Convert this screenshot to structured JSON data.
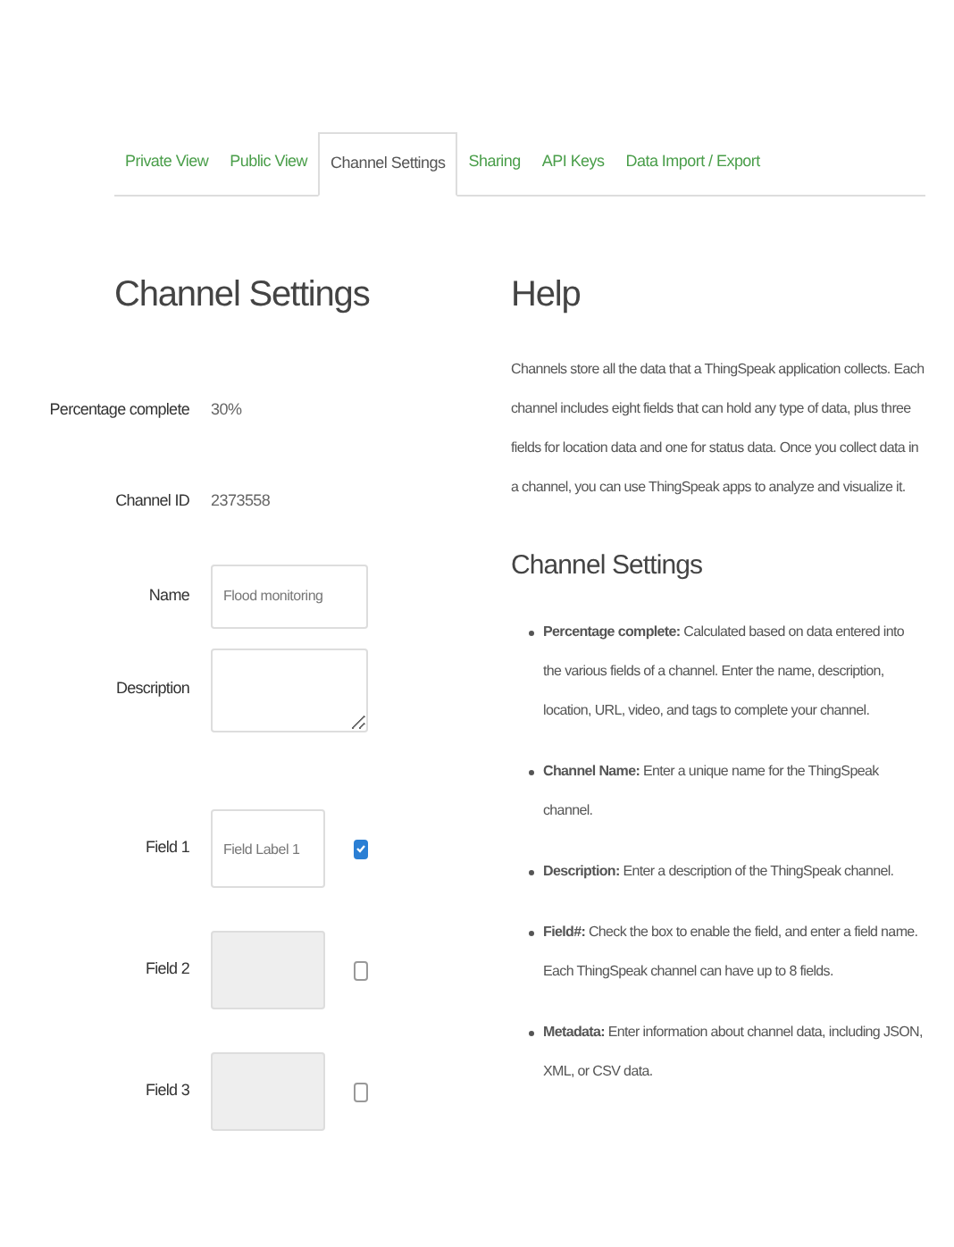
{
  "tabs": [
    {
      "label": "Private View",
      "selected": false
    },
    {
      "label": "Public View",
      "selected": false
    },
    {
      "label": "Channel Settings",
      "selected": true
    },
    {
      "label": "Sharing",
      "selected": false
    },
    {
      "label": "API Keys",
      "selected": false
    },
    {
      "label": "Data Import / Export",
      "selected": false
    }
  ],
  "settings": {
    "title": "Channel Settings",
    "rows": [
      {
        "kind": "text",
        "label": "Percentage complete",
        "value": "30%"
      },
      {
        "kind": "text",
        "label": "Channel ID",
        "value": "2373558"
      },
      {
        "kind": "input",
        "label": "Name",
        "value": "Flood monitoring"
      },
      {
        "kind": "textarea",
        "label": "Description"
      },
      {
        "kind": "field",
        "label": "Field 1",
        "value": "Field Label 1",
        "checked": true
      },
      {
        "kind": "field",
        "label": "Field 2",
        "checked": false
      },
      {
        "kind": "field",
        "label": "Field 3",
        "checked": false
      }
    ]
  },
  "help": {
    "title": "Help",
    "text": "Channels store all the data that a ThingSpeak application collects. Each channel includes eight fields that can hold any type of data, plus three fields for location data and one for status data. Once you collect data in a channel, you can use ThingSpeak apps to analyze and visualize it.",
    "subtitle": "Channel Settings",
    "items": [
      "**Percentage complete:** Calculated based on data entered into the various fields of a channel. Enter the name, description, location, URL, video, and tags to complete your channel.",
      "**Channel Name:** Enter a unique name for the ThingSpeak channel.",
      "**Description:** Enter a description of the ThingSpeak channel.",
      "**Field#:** Check the box to enable the field, and enter a field name. Each ThingSpeak channel can have up to 8 fields.",
      "**Metadata:** Enter information about channel data, including JSON, XML, or CSV data."
    ]
  }
}
